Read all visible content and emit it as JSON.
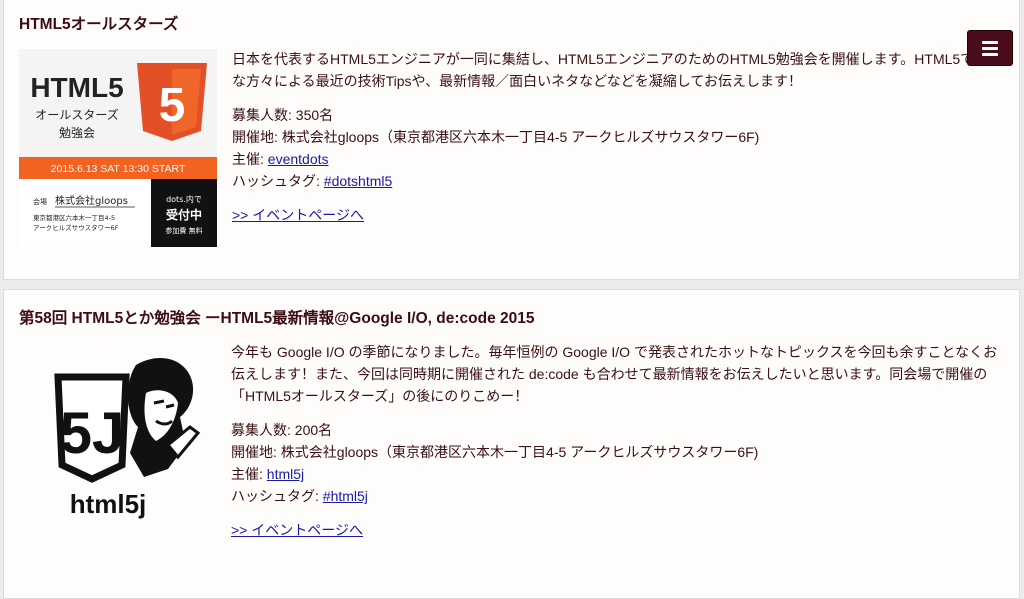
{
  "events": [
    {
      "title": "HTML5オールスターズ",
      "description": "日本を代表するHTML5エンジニアが一同に集結し、HTML5エンジニアのためのHTML5勉強会を開催します。HTML5で著名な方々による最近の技術Tipsや、最新情報／面白いネタなどなどを凝縮してお伝えします！",
      "capacity_label": "募集人数:",
      "capacity": "350名",
      "venue_label": "開催地:",
      "venue": "株式会社gloops（東京都港区六本木一丁目4-5 アークヒルズサウスタワー6F)",
      "organizer_label": "主催:",
      "organizer": "eventdots",
      "hashtag_label": "ハッシュタグ:",
      "hashtag": "#dotshtml5",
      "event_link": ">> イベントページへ",
      "banner": {
        "logo_text": "HTML5",
        "subtitle_1": "オールスターズ",
        "subtitle_2": "勉強会",
        "date": "2015.6.13 SAT 13:30 START",
        "venue_tag": "会場",
        "venue_name": "株式会社gloops",
        "address_1": "東京都港区六本木一丁目4-5",
        "address_2": "アークヒルズサウスタワー6F",
        "badge_1": "dots.内で",
        "badge_2": "受付中",
        "badge_3": "参加費 無料",
        "shield_number": "5"
      }
    },
    {
      "title": "第58回 HTML5とか勉強会 ーHTML5最新情報@Google I/O, de:code 2015",
      "description": "今年も Google I/O の季節になりました。毎年恒例の Google I/O で発表されたホットなトピックスを今回も余すことなくお伝えします！また、今回は同時期に開催された de:code も合わせて最新情報をお伝えしたいと思います。同会場で開催の「HTML5オールスターズ」の後にのりこめー！",
      "capacity_label": "募集人数:",
      "capacity": "200名",
      "venue_label": "開催地:",
      "venue": "株式会社gloops（東京都港区六本木一丁目4-5 アークヒルズサウスタワー6F)",
      "organizer_label": "主催:",
      "organizer": "html5j",
      "hashtag_label": "ハッシュタグ:",
      "hashtag": "#html5j",
      "event_link": ">> イベントページへ",
      "logo": {
        "mark": "5J",
        "text": "html5j"
      }
    }
  ],
  "menu_icon": "hamburger-menu-icon",
  "colors": {
    "title": "#3b0c12",
    "menu_button": "#4a0d1b",
    "link": "#1a1aa8",
    "html5_orange": "#e34f26",
    "banner_date_bar": "#f26322"
  }
}
